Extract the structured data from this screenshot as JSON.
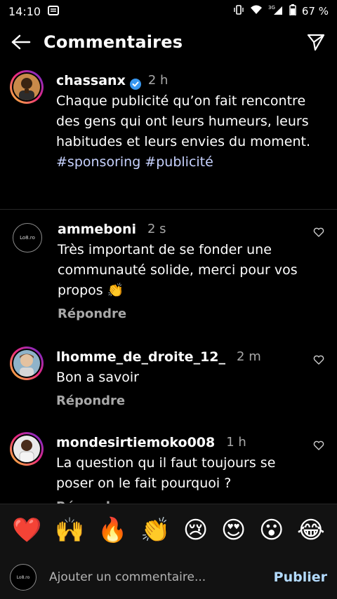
{
  "status": {
    "time": "14:10",
    "battery": "67 %",
    "network": "3G"
  },
  "header": {
    "title": "Commentaires"
  },
  "caption": {
    "username": "chassanx",
    "time": "2 h",
    "text": "Chaque publicité qu’on fait rencontre des gens qui ont leurs humeurs, leurs habitudes et leurs envies du moment.",
    "hashtags": "#sponsoring #publicité"
  },
  "comments": [
    {
      "username": "ammeboni",
      "time": "2 s",
      "text": "Très important de se fonder une communauté solide, merci pour vos propos 👏",
      "reply": "Répondre",
      "avatar_text": "Lo8.ro"
    },
    {
      "username": "lhomme_de_droite_12_",
      "time": "2 m",
      "text": "Bon a savoir",
      "reply": "Répondre"
    },
    {
      "username": "mondesirtiemoko008",
      "time": "1 h",
      "text": "La question qu il faut toujours se poser on le fait pourquoi ?",
      "reply": "Répondre"
    }
  ],
  "emojis": [
    "❤️",
    "🙌",
    "🔥",
    "👏",
    "😢",
    "😍",
    "😮",
    "😂"
  ],
  "composer": {
    "placeholder": "Ajouter un commentaire...",
    "publish": "Publier",
    "avatar_text": "Lo8.ro"
  }
}
